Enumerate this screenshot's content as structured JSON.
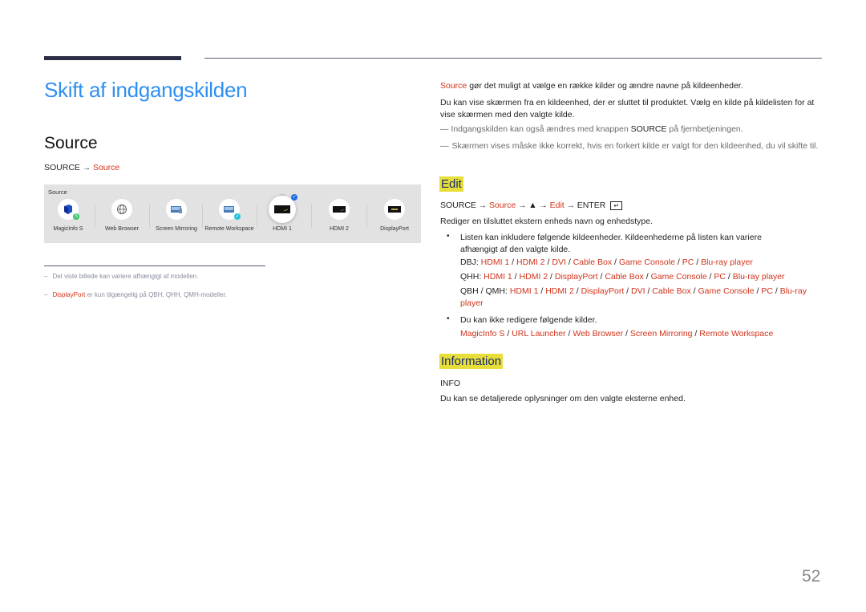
{
  "page": {
    "title": "Skift af indgangskilden",
    "section_heading": "Source",
    "page_number": "52"
  },
  "left": {
    "path": {
      "root": "SOURCE",
      "arrow": "→",
      "target": "Source"
    },
    "source_panel": {
      "label": "Source",
      "sources": [
        {
          "label": "MagicInfo S",
          "icon": "magicinfo-icon"
        },
        {
          "label": "Web Browser",
          "icon": "globe-icon"
        },
        {
          "label": "Screen Mirroring",
          "icon": "screen-mirroring-icon"
        },
        {
          "label": "Remote Workspace",
          "icon": "remote-workspace-icon"
        },
        {
          "label": "HDMI 1",
          "icon": "hdmi-port-icon",
          "selected": true
        },
        {
          "label": "HDMI 2",
          "icon": "hdmi-port-icon"
        },
        {
          "label": "DisplayPort",
          "icon": "displayport-icon"
        }
      ]
    },
    "notes": {
      "dash": "–",
      "note1": "Det viste billede kan variere afhængigt af modellen.",
      "note2_highlight": "DisplayPort",
      "note2_rest": " er kun tilgængelig på QBH, QHH, QMH-modeller."
    }
  },
  "right": {
    "intro_highlight": "Source",
    "intro_rest": " gør det muligt at vælge en række kilder og ændre navne på kildeenheder.",
    "para2": "Du kan vise skærmen fra en kildeenhed, der er sluttet til produktet. Vælg en kilde på kildelisten for at vise skærmen med den valgte kilde.",
    "note_mark": "―",
    "note1_pre": "Indgangskilden kan også ændres med knappen ",
    "note1_bold": "SOURCE",
    "note1_post": " på fjernbetjeningen.",
    "note2": "Skærmen vises måske ikke korrekt, hvis en forkert kilde er valgt for den kildeenhed, du vil skifte til.",
    "edit": {
      "heading": "Edit",
      "path": [
        "SOURCE",
        "Source",
        "▲",
        "Edit",
        "ENTER"
      ],
      "arrow": "→",
      "description": "Rediger en tilsluttet ekstern enheds navn og enhedstype.",
      "bullet1": "Listen kan inkludere følgende kildeenheder. Kildeenhederne på listen kan variere afhængigt af den valgte kilde.",
      "lists": [
        {
          "model": "DBJ:",
          "items": [
            "HDMI 1",
            "HDMI 2",
            "DVI",
            "Cable Box",
            "Game Console",
            "PC",
            "Blu-ray player"
          ]
        },
        {
          "model": "QHH:",
          "items": [
            "HDMI 1",
            "HDMI 2",
            "DisplayPort",
            "Cable Box",
            "Game Console",
            "PC",
            "Blu-ray player"
          ]
        },
        {
          "model": "QBH / QMH:",
          "items": [
            "HDMI 1",
            "HDMI 2",
            "DisplayPort",
            "DVI",
            "Cable Box",
            "Game Console",
            "PC",
            "Blu-ray player"
          ]
        }
      ],
      "bullet2": "Du kan ikke redigere følgende kilder.",
      "non_editable": [
        "MagicInfo S",
        "URL Launcher",
        "Web Browser",
        "Screen Mirroring",
        "Remote Workspace"
      ]
    },
    "information": {
      "heading": "Information",
      "key": "INFO",
      "description": "Du kan se detaljerede oplysninger om den valgte eksterne enhed."
    }
  },
  "colors": {
    "title_blue": "#2f8ff2",
    "highlight_red": "#d3331a",
    "section_yellow": "#e7de3a"
  }
}
